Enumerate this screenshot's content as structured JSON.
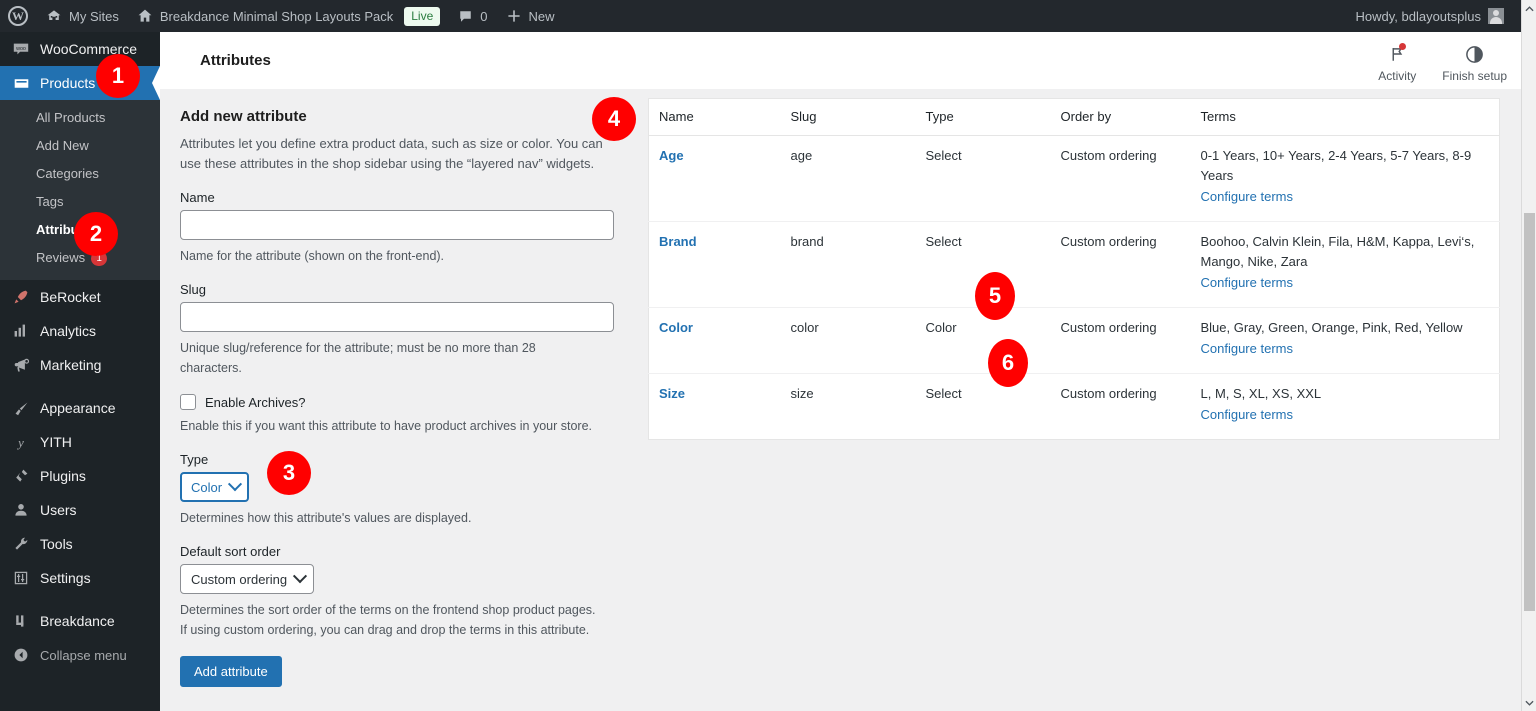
{
  "adminbar": {
    "logo_icon": "wordpress-logo-icon",
    "my_sites": "My Sites",
    "site_name": "Breakdance Minimal Shop Layouts Pack",
    "live_badge": "Live",
    "comment_count": "0",
    "new_label": "New",
    "howdy": "Howdy, bdlayoutsplus"
  },
  "sidebar": {
    "items": [
      {
        "label": "WooCommerce",
        "icon": "woocommerce-icon",
        "current": false
      },
      {
        "label": "Products",
        "icon": "products-icon",
        "current": true
      },
      {
        "label": "BeRocket",
        "icon": "rocket-icon",
        "current": false
      },
      {
        "label": "Analytics",
        "icon": "analytics-icon",
        "current": false
      },
      {
        "label": "Marketing",
        "icon": "megaphone-icon",
        "current": false
      },
      {
        "label": "Appearance",
        "icon": "paintbrush-icon",
        "current": false
      },
      {
        "label": "YITH",
        "icon": "yith-icon",
        "current": false
      },
      {
        "label": "Plugins",
        "icon": "plug-icon",
        "current": false
      },
      {
        "label": "Users",
        "icon": "user-icon",
        "current": false
      },
      {
        "label": "Tools",
        "icon": "wrench-icon",
        "current": false
      },
      {
        "label": "Settings",
        "icon": "settings-icon",
        "current": false
      },
      {
        "label": "Breakdance",
        "icon": "breakdance-icon",
        "current": false
      }
    ],
    "submenu": [
      {
        "label": "All Products",
        "current": false,
        "count": ""
      },
      {
        "label": "Add New",
        "current": false,
        "count": ""
      },
      {
        "label": "Categories",
        "current": false,
        "count": ""
      },
      {
        "label": "Tags",
        "current": false,
        "count": ""
      },
      {
        "label": "Attributes",
        "current": true,
        "count": ""
      },
      {
        "label": "Reviews",
        "current": false,
        "count": "1"
      }
    ],
    "collapse": "Collapse menu"
  },
  "header": {
    "title": "Attributes",
    "activity_label": "Activity",
    "finish_setup_label": "Finish setup"
  },
  "form": {
    "heading": "Add new attribute",
    "description": "Attributes let you define extra product data, such as size or color. You can use these attributes in the shop sidebar using the “layered nav” widgets.",
    "name_label": "Name",
    "name_value": "",
    "name_help": "Name for the attribute (shown on the front-end).",
    "slug_label": "Slug",
    "slug_value": "",
    "slug_help": "Unique slug/reference for the attribute; must be no more than 28 characters.",
    "archives_label": "Enable Archives?",
    "archives_checked": false,
    "archives_help": "Enable this if you want this attribute to have product archives in your store.",
    "type_label": "Type",
    "type_value": "Color",
    "type_help": "Determines how this attribute's values are displayed.",
    "sort_label": "Default sort order",
    "sort_value": "Custom ordering",
    "sort_help": "Determines the sort order of the terms on the frontend shop product pages. If using custom ordering, you can drag and drop the terms in this attribute.",
    "submit_label": "Add attribute"
  },
  "table": {
    "columns": [
      "Name",
      "Slug",
      "Type",
      "Order by",
      "Terms"
    ],
    "configure_label": "Configure terms",
    "rows": [
      {
        "name": "Age",
        "slug": "age",
        "type": "Select",
        "order_by": "Custom ordering",
        "terms": "0-1 Years, 10+ Years, 2-4 Years, 5-7 Years, 8-9 Years"
      },
      {
        "name": "Brand",
        "slug": "brand",
        "type": "Select",
        "order_by": "Custom ordering",
        "terms": "Boohoo, Calvin Klein, Fila, H&M, Kappa, Levi‘s, Mango, Nike, Zara"
      },
      {
        "name": "Color",
        "slug": "color",
        "type": "Color",
        "order_by": "Custom ordering",
        "terms": "Blue, Gray, Green, Orange, Pink, Red, Yellow"
      },
      {
        "name": "Size",
        "slug": "size",
        "type": "Select",
        "order_by": "Custom ordering",
        "terms": "L, M, S, XL, XS, XXL"
      }
    ]
  },
  "markers": [
    {
      "label": "1"
    },
    {
      "label": "2"
    },
    {
      "label": "3"
    },
    {
      "label": "4"
    },
    {
      "label": "5"
    },
    {
      "label": "6"
    }
  ],
  "colors": {
    "accent": "#2271b1",
    "sidebar": "#1d2327",
    "adminbar": "#23282d",
    "marker": "#ff0000",
    "badge": "#d63638"
  }
}
